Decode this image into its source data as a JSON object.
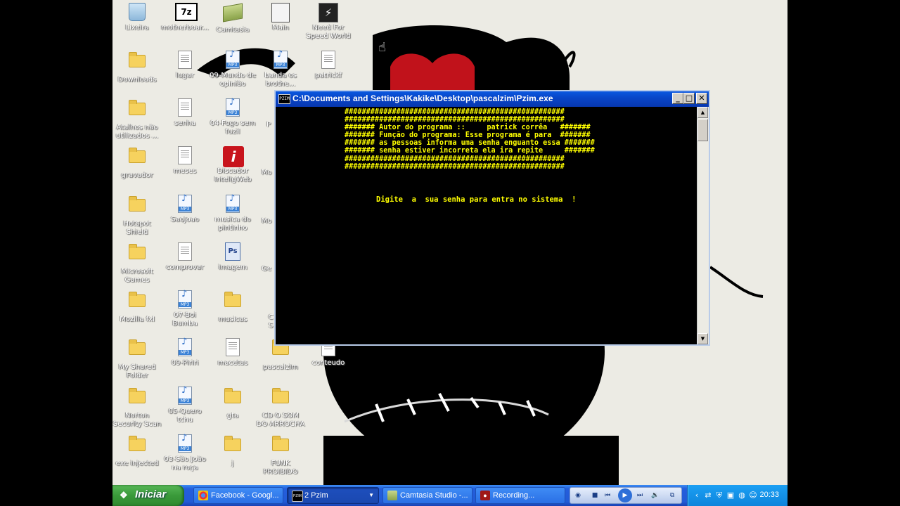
{
  "console_window": {
    "title": "C:\\Documents and Settings\\Kakike\\Desktop\\pascalzim\\Pzim.exe",
    "icon_text": "PZIM",
    "banner": "###################################################\n###################################################\n####### Autor do programa ::     patrick corrêa   #######\n####### Função do programa: Esse programa é para  #######\n####### as pessoas informa uma senha enguanto essa #######\n####### senha estiver incorreta ela ira repite     #######\n###################################################\n###################################################",
    "prompt": "Digite  a  sua senha para entra no sistema  !",
    "buttons": {
      "minimize": "_",
      "maximize": "□",
      "close": "✕"
    }
  },
  "desktop_icons": [
    {
      "name": "recycle-bin-icon",
      "label": "Lixeira",
      "kind": "bin"
    },
    {
      "name": "7zip-icon",
      "label": "motherboar...",
      "kind": "7z",
      "text": "7z"
    },
    {
      "name": "camtasia-icon",
      "label": "Camtasia",
      "kind": "camtasia"
    },
    {
      "name": "main-icon",
      "label": "Main",
      "kind": "main"
    },
    {
      "name": "need-for-speed-icon",
      "label": "Need For Speed World",
      "kind": "nfs",
      "text": "⚡"
    },
    {
      "name": "folder-downloads-icon",
      "label": "Downloads",
      "kind": "folder"
    },
    {
      "name": "doc-lugar-icon",
      "label": "lugar",
      "kind": "doc"
    },
    {
      "name": "mp3-mundo-opiniao-icon",
      "label": "09-Mundo de opinião",
      "kind": "mp3"
    },
    {
      "name": "banda-os-brothers-icon",
      "label": "banda os brothe...",
      "kind": "mp3"
    },
    {
      "name": "patrick-icon",
      "label": "patrickf",
      "kind": "doc"
    },
    {
      "name": "folder-atalhos-icon",
      "label": "Atalhos não utilizados ...",
      "kind": "folder"
    },
    {
      "name": "doc-senha-icon",
      "label": "senha",
      "kind": "doc"
    },
    {
      "name": "mp3-fogo-icon",
      "label": "04-Fogo sem fuzil",
      "kind": "mp3"
    },
    {
      "name": "folder-gravador-icon",
      "label": "gravador",
      "kind": "folder"
    },
    {
      "name": "doc-meses-icon",
      "label": "meses",
      "kind": "doc"
    },
    {
      "name": "discador-icon",
      "label": "Discador InteligWeb",
      "kind": "discador",
      "text": "i"
    },
    {
      "name": "folder-hotspot-icon",
      "label": "Hotspot Shield",
      "kind": "folder"
    },
    {
      "name": "mp3-saojoao-icon",
      "label": "SaoJoao",
      "kind": "mp3"
    },
    {
      "name": "mp3-pintinho-icon",
      "label": "musica do pintinho",
      "kind": "mp3"
    },
    {
      "name": "folder-microsoft-games-icon",
      "label": "Microsoft Games",
      "kind": "folder"
    },
    {
      "name": "doc-comprovar-icon",
      "label": "comprovar",
      "kind": "doc"
    },
    {
      "name": "photoshop-imagem-icon",
      "label": "imagem",
      "kind": "ps",
      "text": "Ps"
    },
    {
      "name": "folder-mozilla-icon",
      "label": "Mozilla fxl",
      "kind": "folder"
    },
    {
      "name": "mp3-boi-bumba-icon",
      "label": "07-Boi Bumba",
      "kind": "mp3"
    },
    {
      "name": "folder-musicas-icon",
      "label": "musicas",
      "kind": "folder"
    },
    {
      "name": "folder-my-shared-icon",
      "label": "My Shared Folder",
      "kind": "folder"
    },
    {
      "name": "mp3-09-icon",
      "label": "09-Piriri",
      "kind": "mp3"
    },
    {
      "name": "doc-macetas-icon",
      "label": "macetas",
      "kind": "doc"
    },
    {
      "name": "folder-pascalzim-icon",
      "label": "pascalzim",
      "kind": "folder"
    },
    {
      "name": "doc-conteudo-icon",
      "label": "conteudo",
      "kind": "doc"
    },
    {
      "name": "folder-norton-icon",
      "label": "Norton Security Scan",
      "kind": "folder"
    },
    {
      "name": "mp3-quero-icon",
      "label": "05-Quero tchu",
      "kind": "mp3"
    },
    {
      "name": "folder-gta-icon",
      "label": "gta",
      "kind": "folder"
    },
    {
      "name": "folder-cd-som-icon",
      "label": "CD O SOM DO ARROCHA",
      "kind": "folder"
    },
    {
      "name": "folder-exe-injected-icon",
      "label": "exe injected",
      "kind": "folder"
    },
    {
      "name": "mp3-sao-joao-icon",
      "label": "03-São João na roça",
      "kind": "mp3"
    },
    {
      "name": "folder-j-icon",
      "label": "j",
      "kind": "folder"
    },
    {
      "name": "folder-funk-icon",
      "label": "FUNK PROIBIDO",
      "kind": "folder"
    }
  ],
  "partial_labels": [
    "P",
    "Mo",
    "Mo",
    "Ge",
    "C",
    "S"
  ],
  "taskbar": {
    "start_label": "Iniciar",
    "tasks": [
      {
        "label": "Facebook - Googl...",
        "icon": "chrome-icon"
      },
      {
        "label": "2 Pzim",
        "icon": "pzim-icon"
      },
      {
        "label": "Camtasia Studio -...",
        "icon": "camtasia-icon"
      },
      {
        "label": "Recording...",
        "icon": "recording-icon"
      }
    ],
    "clock": "20:33"
  }
}
